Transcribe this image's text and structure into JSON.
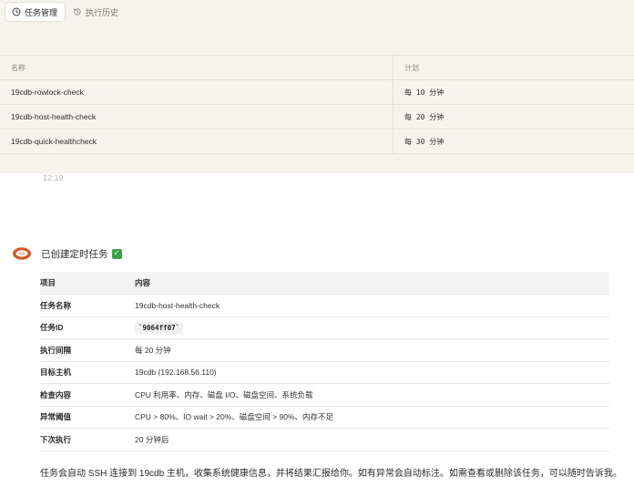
{
  "tabs": [
    {
      "label": "任务管理",
      "icon": "clock-icon",
      "active": true
    },
    {
      "label": "执行历史",
      "icon": "history-icon",
      "active": false
    }
  ],
  "task_table": {
    "columns": [
      "名称",
      "计划"
    ],
    "rows": [
      {
        "name": "19cdb-rowlock-check",
        "schedule": "每 10 分钟"
      },
      {
        "name": "19cdb-host-health-check",
        "schedule": "每 20 分钟"
      },
      {
        "name": "19cdb-quick-healthcheck",
        "schedule": "每 30 分钟"
      }
    ]
  },
  "timestamp": "12:19",
  "message": {
    "title": "已创建定时任务",
    "status_icon": "check-mark-icon",
    "status_color": "#3aa34a",
    "table": {
      "headers": [
        "项目",
        "内容"
      ],
      "rows": [
        {
          "key": "任务名称",
          "value": "19cdb-host-health-check"
        },
        {
          "key": "任务ID",
          "value": "`9064ff07`"
        },
        {
          "key": "执行间隔",
          "value": "每 20 分钟"
        },
        {
          "key": "目标主机",
          "value": "19cdb (192.168.56.110)"
        },
        {
          "key": "检查内容",
          "value": "CPU 利用率、内存、磁盘 I/O、磁盘空间、系统负载"
        },
        {
          "key": "异常阈值",
          "value": "CPU > 80%、IO wait > 20%、磁盘空间 > 90%、内存不足"
        },
        {
          "key": "下次执行",
          "value": "20 分钟后"
        }
      ]
    },
    "footer": "任务会自动 SSH 连接到 19cdb 主机，收集系统健康信息，并将结果汇报给你。如有异常会自动标注。如需查看或删除该任务，可以随时告诉我。"
  },
  "colors": {
    "panel_bg": "#f6f3ee",
    "avatar_accent": "#d35a2c"
  }
}
